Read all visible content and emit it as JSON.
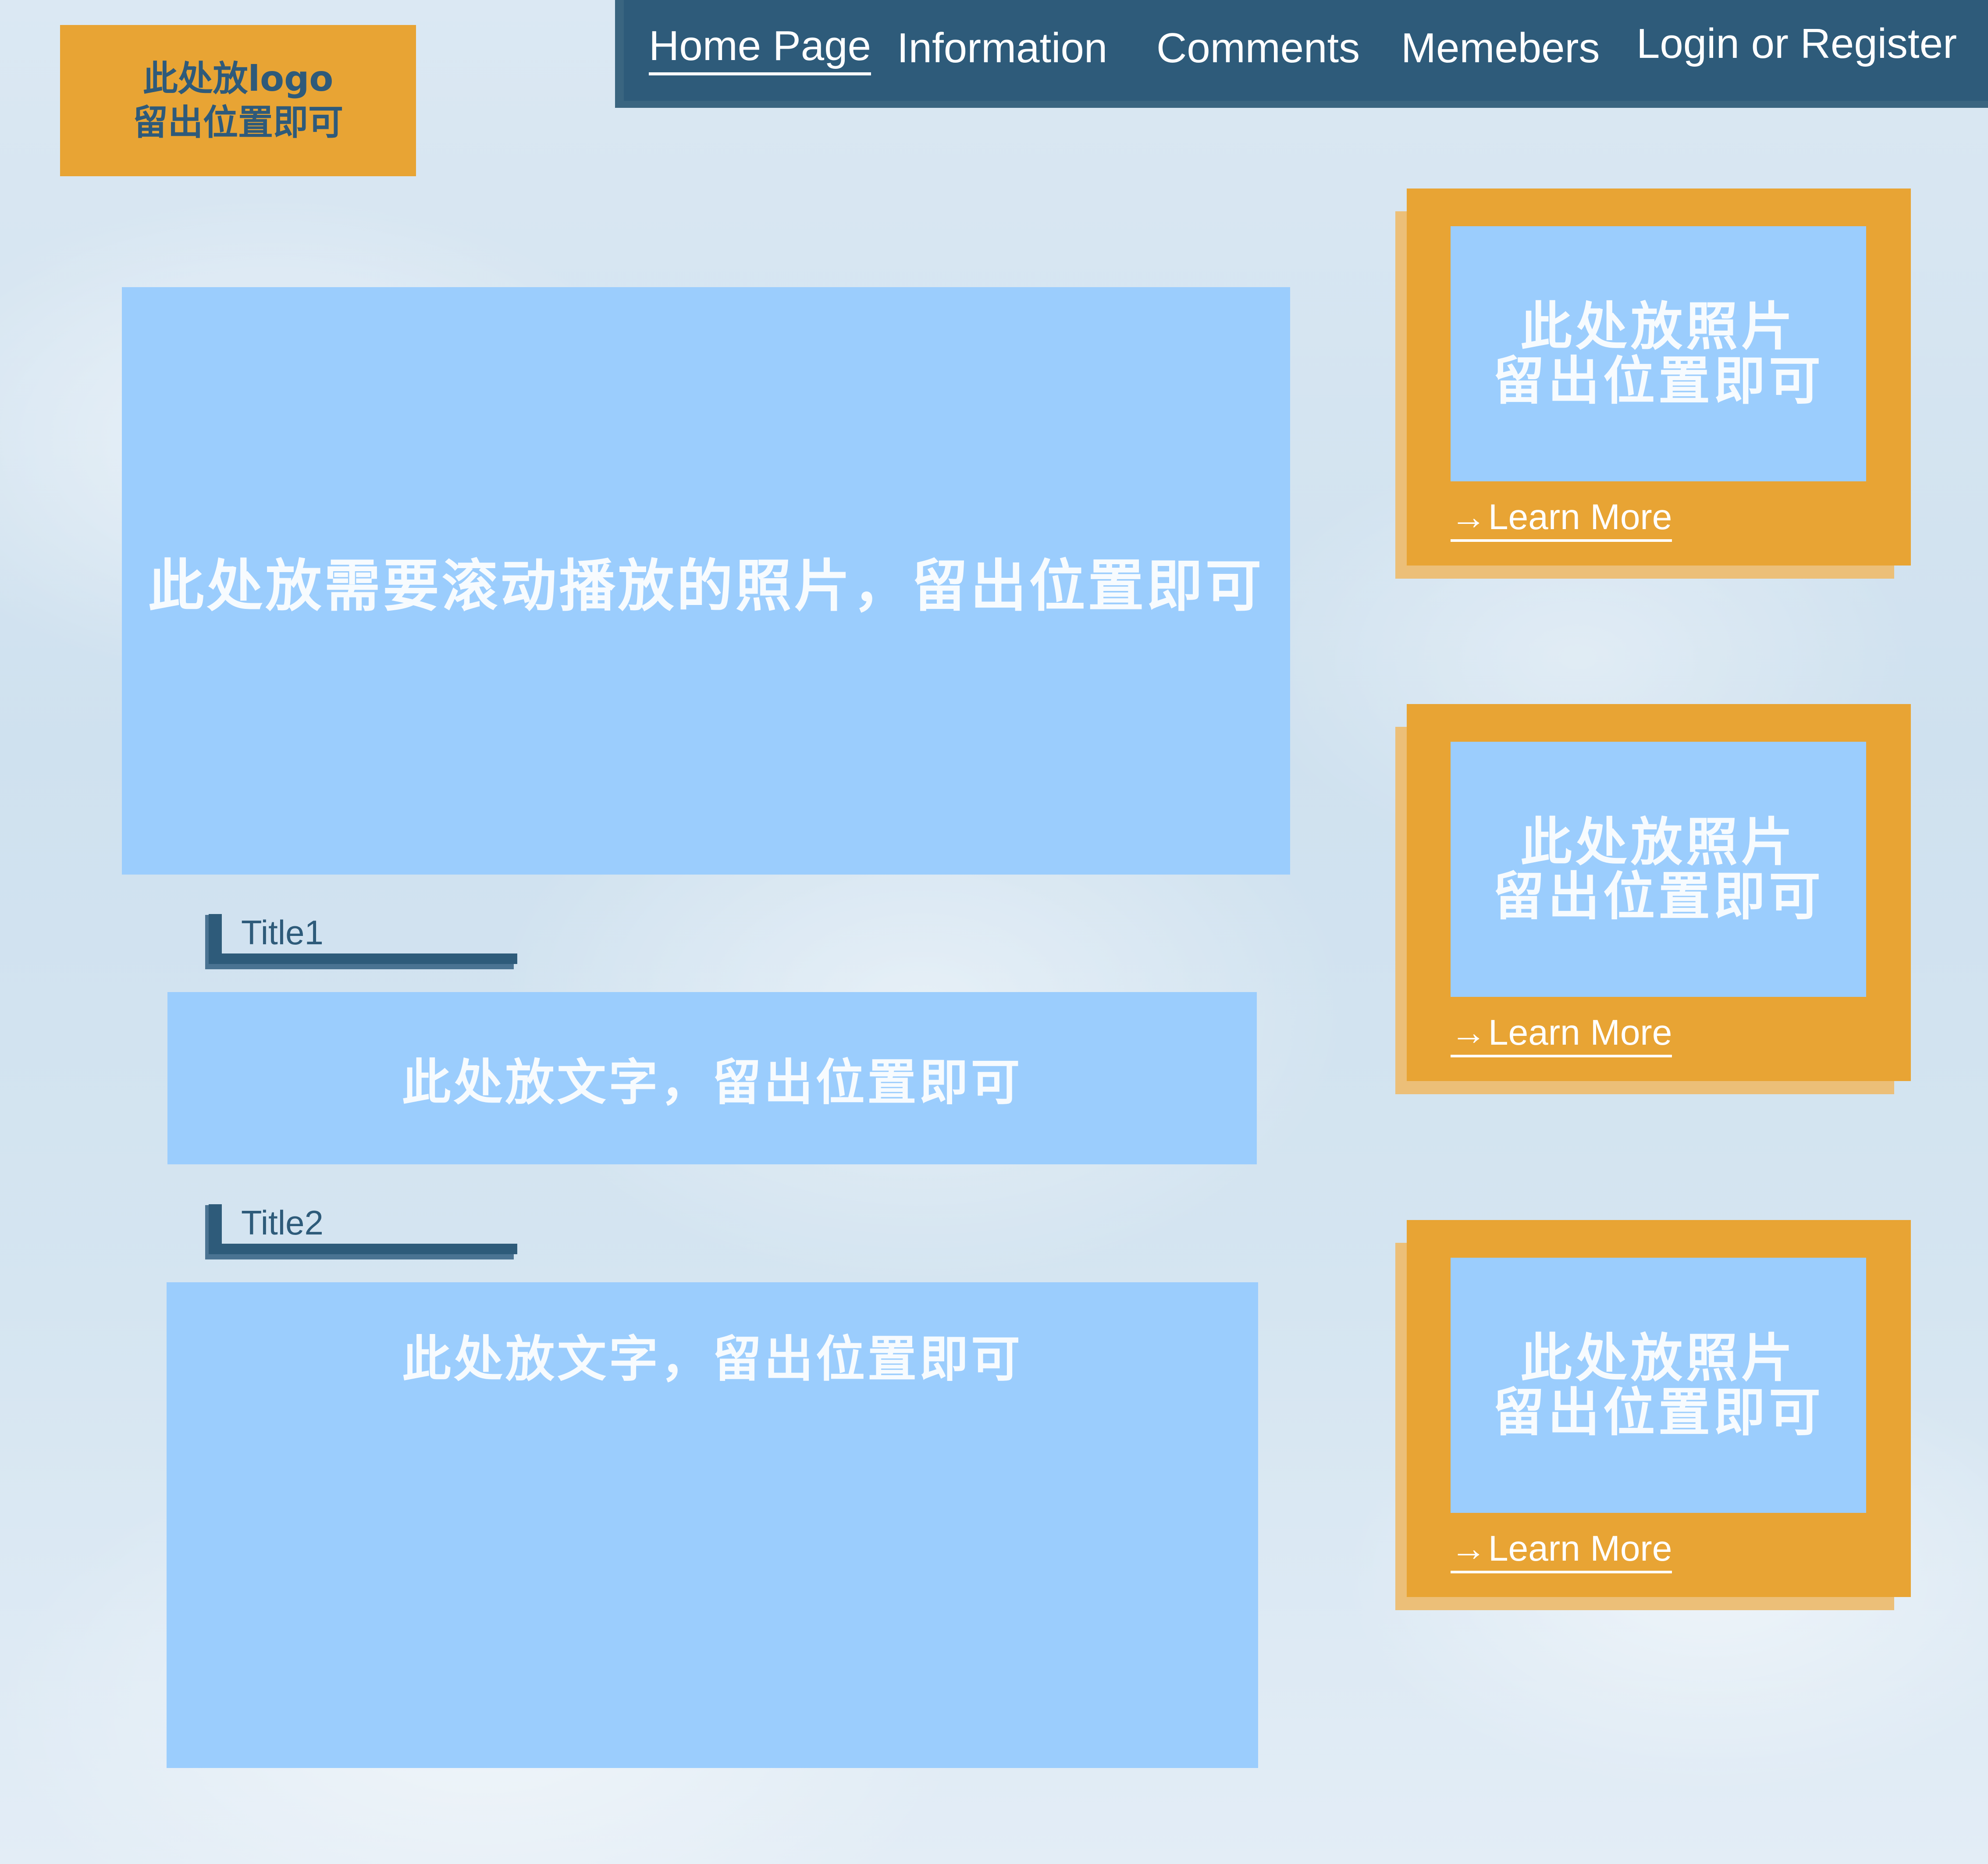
{
  "logo": {
    "line1": "此处放logo",
    "line2": "留出位置即可"
  },
  "nav": {
    "items": [
      {
        "label": "Home Page",
        "active": true
      },
      {
        "label": "Information"
      },
      {
        "label": "Comments"
      },
      {
        "label": "Memebers"
      },
      {
        "label": "Login or Register"
      }
    ]
  },
  "slideshow": {
    "text": "此处放需要滚动播放的照片，留出位置即可"
  },
  "sections": [
    {
      "title": "Title1",
      "text": "此处放文字，留出位置即可"
    },
    {
      "title": "Title2",
      "text": "此处放文字，留出位置即可"
    }
  ],
  "cards": [
    {
      "photo_line1": "此处放照片",
      "photo_line2": "留出位置即可",
      "arrow": "→",
      "link": "Learn More"
    },
    {
      "photo_line1": "此处放照片",
      "photo_line2": "留出位置即可",
      "arrow": "→",
      "link": "Learn More"
    },
    {
      "photo_line1": "此处放照片",
      "photo_line2": "留出位置即可",
      "arrow": "→",
      "link": "Learn More"
    }
  ],
  "colors": {
    "accent_orange": "#e8a434",
    "panel_blue": "#9bcdfd",
    "nav_navy": "#2e5b7a"
  }
}
